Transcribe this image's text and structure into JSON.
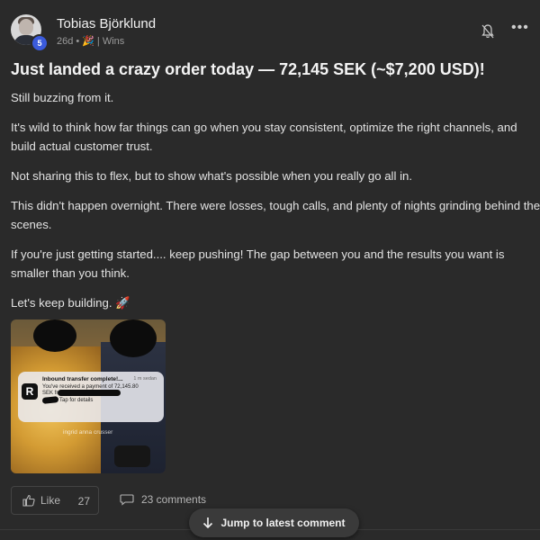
{
  "author": {
    "name": "Tobias Björklund",
    "level": "5",
    "age": "26d",
    "separator": "•",
    "category_icon": "party-popper-icon",
    "category": "| Wins"
  },
  "post": {
    "title": "Just landed a crazy order today — 72,145 SEK (~$7,200 USD)!",
    "paragraphs": [
      "Still buzzing from it.",
      "It's wild to think how far things can go when you stay consistent, optimize the right channels, and build actual customer trust.",
      "Not sharing this to flex, but to show what's possible when you really go all in.",
      "This didn't happen overnight. There were losses, tough calls, and plenty of nights grinding behind the scenes.",
      "If you're just getting started.... keep pushing! The gap between you and the results you want is smaller than you think.",
      "Let's keep building. 🚀"
    ],
    "image": {
      "notification": {
        "app_letter": "R",
        "title": "Inbound transfer complete!...",
        "time": "1 m sedan",
        "line1": "You've received a payment of 72,145.80",
        "line2": "SEK from",
        "line3": "Tap for details"
      },
      "watermark": "ingrid anna crusser"
    }
  },
  "actions": {
    "like_label": "Like",
    "like_count": "27",
    "comments_label": "23 comments",
    "jump_label": "Jump to latest comment"
  },
  "colors": {
    "background": "#2a2a2a",
    "badge": "#3b5bdb",
    "text": "#e3e3e3"
  }
}
